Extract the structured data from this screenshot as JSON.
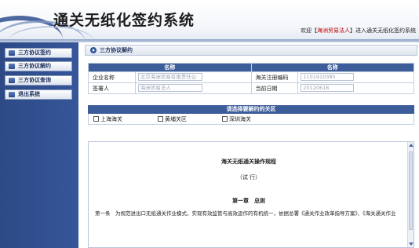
{
  "header": {
    "title": "通关无纸化签约系统",
    "welcome_prefix": "欢迎【",
    "user": "海洲贸易法人",
    "welcome_suffix": "】进入通关无纸化签约系统"
  },
  "sidebar": {
    "items": [
      {
        "label": "三方协议签约"
      },
      {
        "label": "三方协议解约"
      },
      {
        "label": "三方协议查询"
      },
      {
        "label": "退出系统"
      }
    ]
  },
  "section": {
    "title": "三方协议解约"
  },
  "info_table": {
    "col_name_1": "名称",
    "col_name_2": "名称",
    "company_label": "企业名称",
    "company_value": "北京海洲贸易有限责任公",
    "customs_code_label": "海关注册编码",
    "customs_code_value": "1101910385",
    "signer_label": "签署人",
    "signer_value": "海洲贸易法人",
    "date_label": "当前日期",
    "date_value": "20120618"
  },
  "customs": {
    "header": "请选择要解约的关区",
    "options": [
      {
        "label": "上海海关",
        "checked": false
      },
      {
        "label": "黄埔关区",
        "checked": false
      },
      {
        "label": "深圳海关",
        "checked": false
      }
    ]
  },
  "document": {
    "title": "海关无纸通关操作规程",
    "subtitle": "（试 行）",
    "chapter": "第一章　总则",
    "paragraph": "第一条　为规范进出口无纸通关作业模式，实现有效监管与高效运作的有机统一，依据总署《通关作业改革指导方案》、《海关通关作业"
  },
  "colors": {
    "brand": "#2d4a86",
    "table_header": "#3c5c9a",
    "user_highlight": "#c00000"
  }
}
